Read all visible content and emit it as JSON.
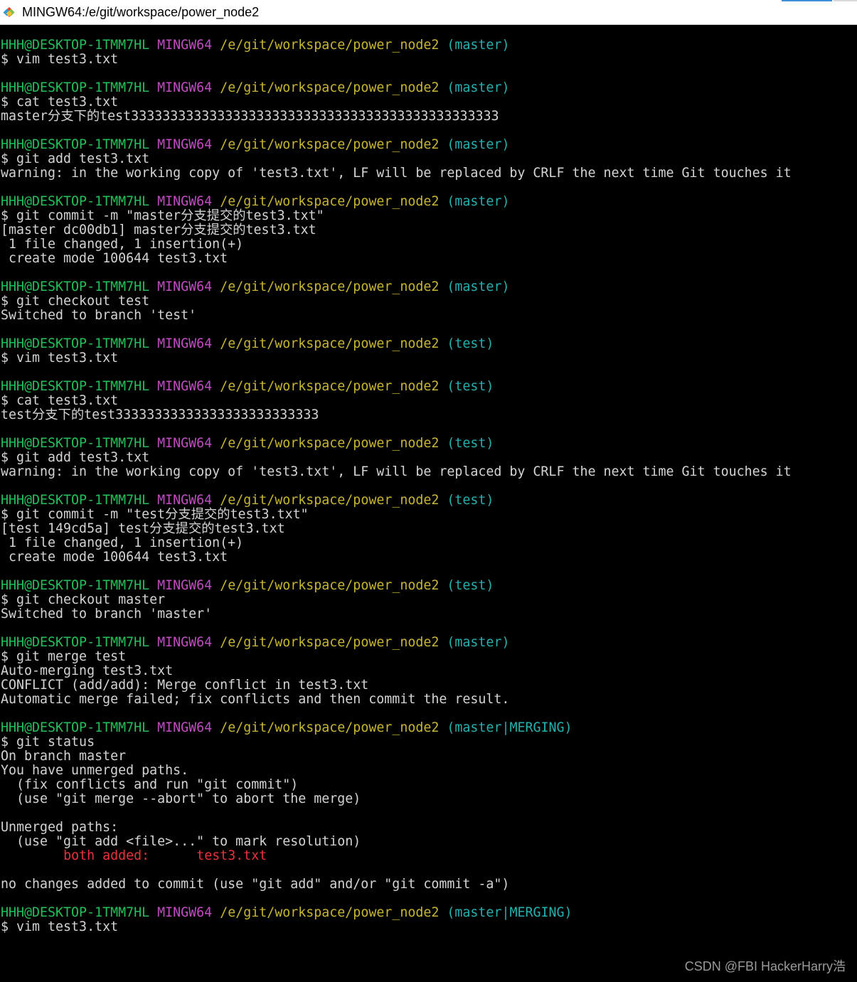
{
  "window": {
    "title": "MINGW64:/e/git/workspace/power_node2",
    "icon": "git-for-windows-icon"
  },
  "colors": {
    "background": "#000000",
    "text": "#d4d4d4",
    "user_host": "#22c05a",
    "mingw": "#c04cc0",
    "path": "#c8b630",
    "branch": "#25b0b0",
    "conflict": "#e8323c"
  },
  "terminal": {
    "prompt_user": "HHH@DESKTOP-1TMM7HL",
    "prompt_env": "MINGW64",
    "prompt_path": "/e/git/workspace/power_node2",
    "lines": [
      {
        "type": "prompt",
        "branch": "(master)"
      },
      {
        "type": "text",
        "text": "$ vim test3.txt"
      },
      {
        "type": "blank"
      },
      {
        "type": "prompt",
        "branch": "(master)"
      },
      {
        "type": "text",
        "text": "$ cat test3.txt"
      },
      {
        "type": "text",
        "text": "master分支下的test33333333333333333333333333333333333333333333333"
      },
      {
        "type": "blank"
      },
      {
        "type": "prompt",
        "branch": "(master)"
      },
      {
        "type": "text",
        "text": "$ git add test3.txt"
      },
      {
        "type": "text",
        "text": "warning: in the working copy of 'test3.txt', LF will be replaced by CRLF the next time Git touches it"
      },
      {
        "type": "blank"
      },
      {
        "type": "prompt",
        "branch": "(master)"
      },
      {
        "type": "text",
        "text": "$ git commit -m \"master分支提交的test3.txt\""
      },
      {
        "type": "text",
        "text": "[master dc00db1] master分支提交的test3.txt"
      },
      {
        "type": "text",
        "text": " 1 file changed, 1 insertion(+)"
      },
      {
        "type": "text",
        "text": " create mode 100644 test3.txt"
      },
      {
        "type": "blank"
      },
      {
        "type": "prompt",
        "branch": "(master)"
      },
      {
        "type": "text",
        "text": "$ git checkout test"
      },
      {
        "type": "text",
        "text": "Switched to branch 'test'"
      },
      {
        "type": "blank"
      },
      {
        "type": "prompt",
        "branch": "(test)"
      },
      {
        "type": "text",
        "text": "$ vim test3.txt"
      },
      {
        "type": "blank"
      },
      {
        "type": "prompt",
        "branch": "(test)"
      },
      {
        "type": "text",
        "text": "$ cat test3.txt"
      },
      {
        "type": "text",
        "text": "test分支下的test33333333333333333333333333"
      },
      {
        "type": "blank"
      },
      {
        "type": "prompt",
        "branch": "(test)"
      },
      {
        "type": "text",
        "text": "$ git add test3.txt"
      },
      {
        "type": "text",
        "text": "warning: in the working copy of 'test3.txt', LF will be replaced by CRLF the next time Git touches it"
      },
      {
        "type": "blank"
      },
      {
        "type": "prompt",
        "branch": "(test)"
      },
      {
        "type": "text",
        "text": "$ git commit -m \"test分支提交的test3.txt\""
      },
      {
        "type": "text",
        "text": "[test 149cd5a] test分支提交的test3.txt"
      },
      {
        "type": "text",
        "text": " 1 file changed, 1 insertion(+)"
      },
      {
        "type": "text",
        "text": " create mode 100644 test3.txt"
      },
      {
        "type": "blank"
      },
      {
        "type": "prompt",
        "branch": "(test)"
      },
      {
        "type": "text",
        "text": "$ git checkout master"
      },
      {
        "type": "text",
        "text": "Switched to branch 'master'"
      },
      {
        "type": "blank"
      },
      {
        "type": "prompt",
        "branch": "(master)"
      },
      {
        "type": "text",
        "text": "$ git merge test"
      },
      {
        "type": "text",
        "text": "Auto-merging test3.txt"
      },
      {
        "type": "text",
        "text": "CONFLICT (add/add): Merge conflict in test3.txt"
      },
      {
        "type": "text",
        "text": "Automatic merge failed; fix conflicts and then commit the result."
      },
      {
        "type": "blank"
      },
      {
        "type": "prompt",
        "branch": "(master|MERGING)"
      },
      {
        "type": "text",
        "text": "$ git status"
      },
      {
        "type": "text",
        "text": "On branch master"
      },
      {
        "type": "text",
        "text": "You have unmerged paths."
      },
      {
        "type": "text",
        "text": "  (fix conflicts and run \"git commit\")"
      },
      {
        "type": "text",
        "text": "  (use \"git merge --abort\" to abort the merge)"
      },
      {
        "type": "blank"
      },
      {
        "type": "text",
        "text": "Unmerged paths:"
      },
      {
        "type": "text",
        "text": "  (use \"git add <file>...\" to mark resolution)"
      },
      {
        "type": "conflict",
        "indent": "        ",
        "status": "both added:",
        "gap": "      ",
        "file": "test3.txt"
      },
      {
        "type": "blank"
      },
      {
        "type": "text",
        "text": "no changes added to commit (use \"git add\" and/or \"git commit -a\")"
      },
      {
        "type": "blank"
      },
      {
        "type": "prompt",
        "branch": "(master|MERGING)"
      },
      {
        "type": "text",
        "text": "$ vim test3.txt"
      }
    ]
  },
  "watermark": "CSDN @FBI HackerHarry浩"
}
